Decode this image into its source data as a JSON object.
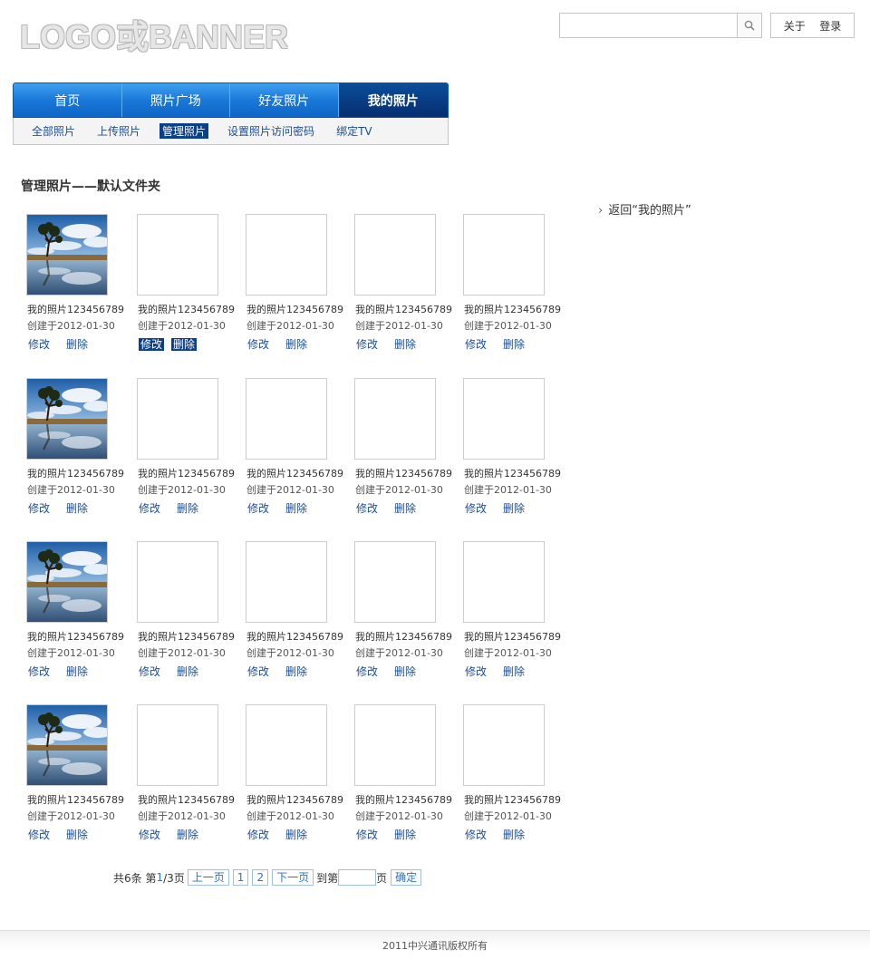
{
  "header": {
    "logo_text": "LOGO或BANNER",
    "search": {
      "value": "",
      "placeholder": ""
    },
    "links": [
      "关于",
      "登录"
    ]
  },
  "nav": {
    "tabs": [
      {
        "label": "首页",
        "active": false
      },
      {
        "label": "照片广场",
        "active": false
      },
      {
        "label": "好友照片",
        "active": false
      },
      {
        "label": "我的照片",
        "active": true
      }
    ],
    "subnav": [
      {
        "label": "全部照片",
        "active": false
      },
      {
        "label": "上传照片",
        "active": false
      },
      {
        "label": "管理照片",
        "active": true
      },
      {
        "label": "设置照片访问密码",
        "active": false
      },
      {
        "label": "绑定TV",
        "active": false
      }
    ]
  },
  "main": {
    "title": "管理照片——默认文件夹",
    "back_link": "返回“我的照片”",
    "photos": [
      {
        "name": "我的照片123456789",
        "date": "创建于2012-01-30",
        "has_image": true,
        "edit": "修改",
        "delete": "删除",
        "highlighted": false
      },
      {
        "name": "我的照片123456789",
        "date": "创建于2012-01-30",
        "has_image": false,
        "edit": "修改",
        "delete": "删除",
        "highlighted": true
      },
      {
        "name": "我的照片123456789",
        "date": "创建于2012-01-30",
        "has_image": false,
        "edit": "修改",
        "delete": "删除",
        "highlighted": false
      },
      {
        "name": "我的照片123456789",
        "date": "创建于2012-01-30",
        "has_image": false,
        "edit": "修改",
        "delete": "删除",
        "highlighted": false
      },
      {
        "name": "我的照片123456789",
        "date": "创建于2012-01-30",
        "has_image": false,
        "edit": "修改",
        "delete": "删除",
        "highlighted": false
      },
      {
        "name": "我的照片123456789",
        "date": "创建于2012-01-30",
        "has_image": true,
        "edit": "修改",
        "delete": "删除",
        "highlighted": false
      },
      {
        "name": "我的照片123456789",
        "date": "创建于2012-01-30",
        "has_image": false,
        "edit": "修改",
        "delete": "删除",
        "highlighted": false
      },
      {
        "name": "我的照片123456789",
        "date": "创建于2012-01-30",
        "has_image": false,
        "edit": "修改",
        "delete": "删除",
        "highlighted": false
      },
      {
        "name": "我的照片123456789",
        "date": "创建于2012-01-30",
        "has_image": false,
        "edit": "修改",
        "delete": "删除",
        "highlighted": false
      },
      {
        "name": "我的照片123456789",
        "date": "创建于2012-01-30",
        "has_image": false,
        "edit": "修改",
        "delete": "删除",
        "highlighted": false
      },
      {
        "name": "我的照片123456789",
        "date": "创建于2012-01-30",
        "has_image": true,
        "edit": "修改",
        "delete": "删除",
        "highlighted": false
      },
      {
        "name": "我的照片123456789",
        "date": "创建于2012-01-30",
        "has_image": false,
        "edit": "修改",
        "delete": "删除",
        "highlighted": false
      },
      {
        "name": "我的照片123456789",
        "date": "创建于2012-01-30",
        "has_image": false,
        "edit": "修改",
        "delete": "删除",
        "highlighted": false
      },
      {
        "name": "我的照片123456789",
        "date": "创建于2012-01-30",
        "has_image": false,
        "edit": "修改",
        "delete": "删除",
        "highlighted": false
      },
      {
        "name": "我的照片123456789",
        "date": "创建于2012-01-30",
        "has_image": false,
        "edit": "修改",
        "delete": "删除",
        "highlighted": false
      },
      {
        "name": "我的照片123456789",
        "date": "创建于2012-01-30",
        "has_image": true,
        "edit": "修改",
        "delete": "删除",
        "highlighted": false
      },
      {
        "name": "我的照片123456789",
        "date": "创建于2012-01-30",
        "has_image": false,
        "edit": "修改",
        "delete": "删除",
        "highlighted": false
      },
      {
        "name": "我的照片123456789",
        "date": "创建于2012-01-30",
        "has_image": false,
        "edit": "修改",
        "delete": "删除",
        "highlighted": false
      },
      {
        "name": "我的照片123456789",
        "date": "创建于2012-01-30",
        "has_image": false,
        "edit": "修改",
        "delete": "删除",
        "highlighted": false
      },
      {
        "name": "我的照片123456789",
        "date": "创建于2012-01-30",
        "has_image": false,
        "edit": "修改",
        "delete": "删除",
        "highlighted": false
      }
    ]
  },
  "pager": {
    "total_text": "共6条 第 ",
    "current": "1",
    "pages_text": "/3页",
    "prev": "上一页",
    "page_numbers": [
      "1",
      "2"
    ],
    "next": "下一页",
    "goto_prefix": "到第",
    "goto_value": "",
    "goto_suffix": "页",
    "confirm": "确定"
  },
  "footer": {
    "text": "2011中兴通讯版权所有"
  },
  "colors": {
    "nav_blue": "#1a78d8",
    "nav_active": "#062e70",
    "link": "#1a4f94",
    "pager_link": "#2a73c8"
  }
}
